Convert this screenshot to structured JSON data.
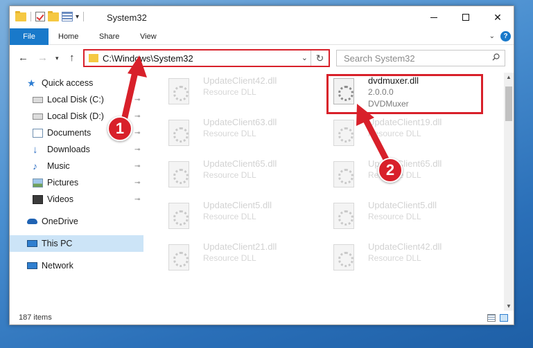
{
  "window": {
    "title": "System32",
    "caption_buttons": {
      "minimize": "—",
      "maximize": "□",
      "close": "✕"
    }
  },
  "ribbon": {
    "tabs": [
      {
        "label": "File"
      },
      {
        "label": "Home"
      },
      {
        "label": "Share"
      },
      {
        "label": "View"
      }
    ],
    "expand_icon": "chevron-down-icon",
    "help_label": "?"
  },
  "address": {
    "path": "C:\\Windows\\System32",
    "dropdown": "⌄",
    "refresh": "↻"
  },
  "search": {
    "placeholder": "Search System32",
    "icon": "search-icon"
  },
  "nav": {
    "back": "←",
    "forward": "→",
    "recent": "▾",
    "up": "↑"
  },
  "sidebar": {
    "items": [
      {
        "label": "Quick access",
        "icon": "star-icon"
      },
      {
        "label": "Local Disk (C:)",
        "icon": "drive-icon",
        "pinned": "📌"
      },
      {
        "label": "Local Disk (D:)",
        "icon": "drive-icon",
        "pinned": "📌"
      },
      {
        "label": "Documents",
        "icon": "documents-icon",
        "pinned": "📌"
      },
      {
        "label": "Downloads",
        "icon": "downloads-icon",
        "pinned": "📌"
      },
      {
        "label": "Music",
        "icon": "music-icon",
        "pinned": "📌"
      },
      {
        "label": "Pictures",
        "icon": "pictures-icon",
        "pinned": "📌"
      },
      {
        "label": "Videos",
        "icon": "videos-icon",
        "pinned": "📌"
      },
      {
        "label": "OneDrive",
        "icon": "cloud-icon"
      },
      {
        "label": "This PC",
        "icon": "computer-icon",
        "selected": true
      },
      {
        "label": "Network",
        "icon": "network-icon"
      }
    ]
  },
  "files": [
    {
      "name": "UpdateClient42.dll",
      "type": "Resource DLL",
      "version": ""
    },
    {
      "name": "dvdmuxer.dll",
      "type": "2.0.0.0",
      "version": "DVDMuxer",
      "highlighted": true
    },
    {
      "name": "UpdateClient63.dll",
      "type": "Resource DLL",
      "version": ""
    },
    {
      "name": "UpdateClient19.dll",
      "type": "Resource DLL",
      "version": ""
    },
    {
      "name": "UpdateClient65.dll",
      "type": "Resource DLL",
      "version": ""
    },
    {
      "name": "UpdateClient65.dll",
      "type": "Resource DLL",
      "version": ""
    },
    {
      "name": "UpdateClient5.dll",
      "type": "Resource DLL",
      "version": ""
    },
    {
      "name": "UpdateClient5.dll",
      "type": "Resource DLL",
      "version": ""
    },
    {
      "name": "UpdateClient21.dll",
      "type": "Resource DLL",
      "version": ""
    },
    {
      "name": "UpdateClient42.dll",
      "type": "Resource DLL",
      "version": ""
    }
  ],
  "status": {
    "item_count": "187 items"
  },
  "callouts": [
    {
      "number": "1"
    },
    {
      "number": "2"
    }
  ],
  "colors": {
    "accent": "#1979ca",
    "annotation": "#d8202a",
    "selected_bg": "#cce4f7"
  }
}
